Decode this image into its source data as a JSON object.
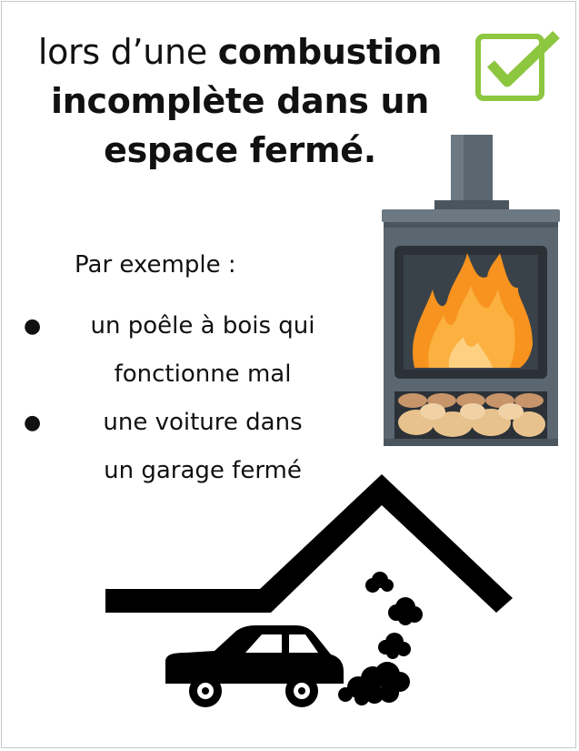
{
  "title": {
    "prefix": "lors d’une",
    "bold1": "combustion",
    "line2": "incomplète dans un",
    "line3": "espace fermé."
  },
  "intro": "Par exemple :",
  "examples": [
    {
      "line1": "un poêle à bois qui",
      "line2": "fonctionne mal"
    },
    {
      "line1": "une voiture dans",
      "line2": "un garage fermé"
    }
  ],
  "colors": {
    "check": "#8dc63f",
    "stove_body": "#5a6670",
    "stove_dark": "#2b3137",
    "flame_outer": "#f7931e",
    "flame_inner": "#fbb040",
    "logs": "#e8c28c",
    "silhouette": "#000000"
  },
  "icons": [
    "checkmark-icon",
    "wood-stove-icon",
    "house-roof-icon",
    "car-icon",
    "exhaust-smoke-icon"
  ]
}
